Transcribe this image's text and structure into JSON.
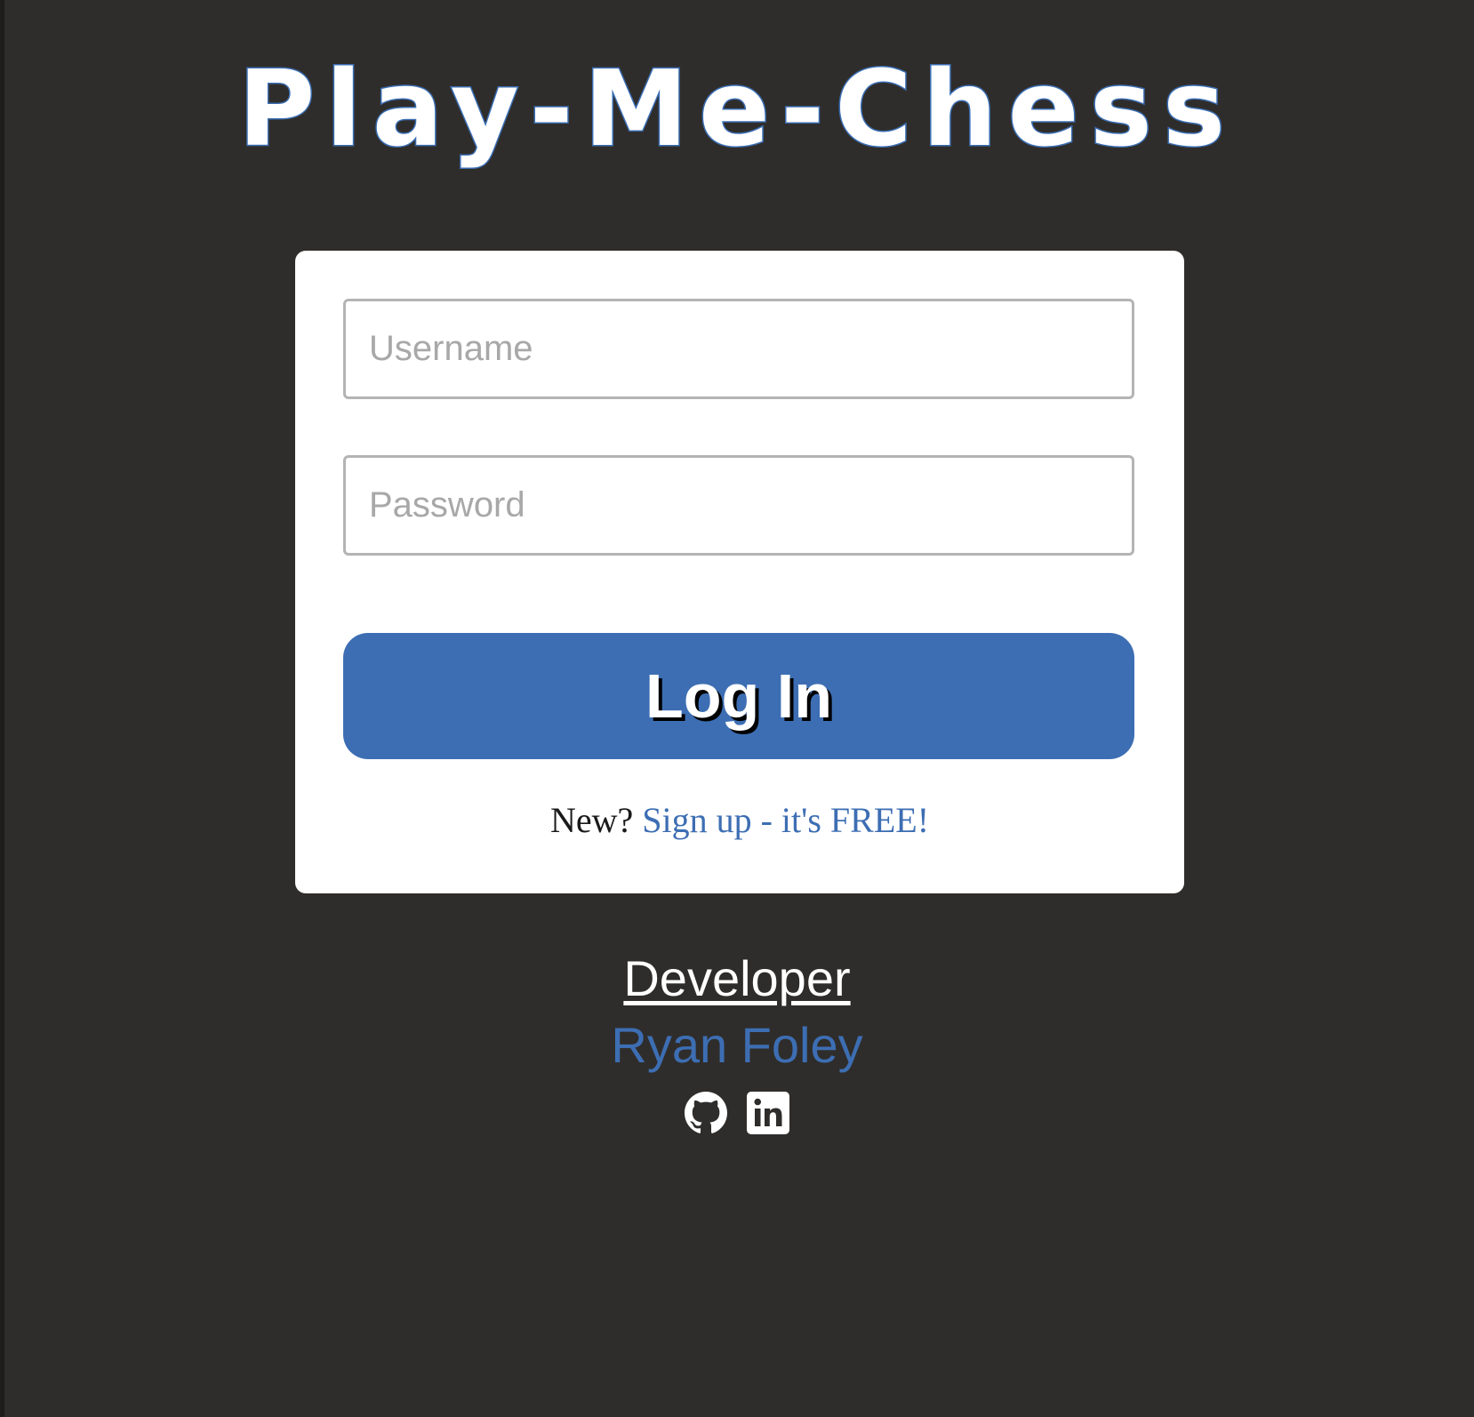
{
  "app": {
    "title": "Play-Me-Chess"
  },
  "login_form": {
    "username_placeholder": "Username",
    "password_placeholder": "Password",
    "submit_label": "Log In",
    "signup_prompt": "New?",
    "signup_link_label": "Sign up - it's FREE!"
  },
  "footer": {
    "heading": "Developer",
    "developer_name": "Ryan Foley",
    "social_icons": [
      "github-icon",
      "linkedin-icon"
    ]
  },
  "colors": {
    "background": "#2f2d2b",
    "accent": "#3d6eb3",
    "card": "#ffffff"
  }
}
